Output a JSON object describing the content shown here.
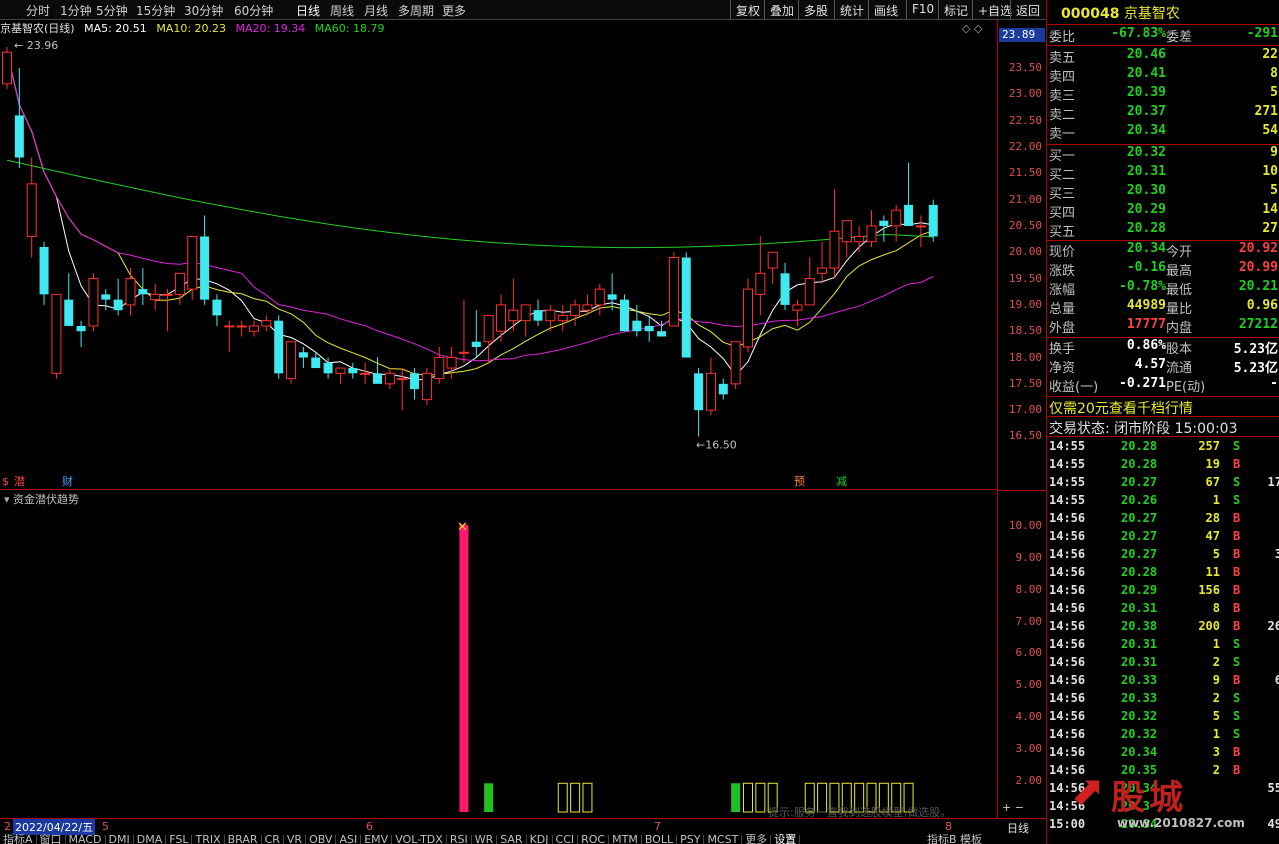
{
  "toolbar": {
    "periods": [
      "分时",
      "1分钟",
      "5分钟",
      "15分钟",
      "30分钟",
      "60分钟",
      "日线",
      "周线",
      "月线",
      "多周期",
      "更多"
    ],
    "active_period": "日线",
    "right_buttons": [
      "复权",
      "叠加",
      "多股",
      "统计",
      "画线",
      "F10",
      "标记",
      "+自选",
      "返回"
    ]
  },
  "ma_line": {
    "title": "京基智农(日线)",
    "ma5": "MA5: 20.51",
    "ma10": "MA10: 20.23",
    "ma20": "MA20: 19.34",
    "ma60": "MA60: 18.79",
    "colors": {
      "ma5": "#ffffff",
      "ma10": "#e8e830",
      "ma20": "#e020e0",
      "ma60": "#20d020"
    }
  },
  "chart_data": [
    {
      "type": "candlestick",
      "ylim": [
        16.3,
        23.9
      ],
      "y_ticks": [
        "23.50",
        "23.00",
        "22.50",
        "22.00",
        "21.50",
        "21.00",
        "20.50",
        "20.00",
        "19.50",
        "19.00",
        "18.50",
        "18.00",
        "17.50",
        "17.00",
        "16.50"
      ],
      "current_price_label": "23.89",
      "annotations": {
        "high": "23.96",
        "low": "16.50"
      },
      "markers": [
        "潜",
        "财",
        "预",
        "减"
      ],
      "candles": [
        {
          "o": 23.2,
          "h": 23.9,
          "l": 23.1,
          "c": 23.8
        },
        {
          "o": 22.6,
          "h": 23.5,
          "l": 21.6,
          "c": 21.8
        },
        {
          "o": 20.3,
          "h": 21.8,
          "l": 19.9,
          "c": 21.3
        },
        {
          "o": 20.1,
          "h": 20.2,
          "l": 19.0,
          "c": 19.2
        },
        {
          "o": 17.7,
          "h": 19.2,
          "l": 17.6,
          "c": 19.2
        },
        {
          "o": 19.1,
          "h": 19.6,
          "l": 18.7,
          "c": 18.6
        },
        {
          "o": 18.6,
          "h": 18.7,
          "l": 18.2,
          "c": 18.5
        },
        {
          "o": 18.6,
          "h": 19.6,
          "l": 18.5,
          "c": 19.5
        },
        {
          "o": 19.2,
          "h": 19.3,
          "l": 18.9,
          "c": 19.1
        },
        {
          "o": 19.1,
          "h": 19.5,
          "l": 18.8,
          "c": 18.9
        },
        {
          "o": 19.0,
          "h": 19.7,
          "l": 18.8,
          "c": 19.5
        },
        {
          "o": 19.3,
          "h": 19.7,
          "l": 19.0,
          "c": 19.2
        },
        {
          "o": 19.1,
          "h": 19.4,
          "l": 18.9,
          "c": 19.2
        },
        {
          "o": 19.2,
          "h": 19.3,
          "l": 18.5,
          "c": 19.2
        },
        {
          "o": 19.2,
          "h": 19.6,
          "l": 19.0,
          "c": 19.6
        },
        {
          "o": 19.3,
          "h": 20.3,
          "l": 19.1,
          "c": 20.3
        },
        {
          "o": 20.3,
          "h": 20.7,
          "l": 19.0,
          "c": 19.1
        },
        {
          "o": 19.1,
          "h": 19.2,
          "l": 18.6,
          "c": 18.8
        },
        {
          "o": 18.6,
          "h": 18.7,
          "l": 18.1,
          "c": 18.6
        },
        {
          "o": 18.6,
          "h": 18.7,
          "l": 18.4,
          "c": 18.6
        },
        {
          "o": 18.5,
          "h": 18.7,
          "l": 18.4,
          "c": 18.6
        },
        {
          "o": 18.6,
          "h": 18.8,
          "l": 18.5,
          "c": 18.7
        },
        {
          "o": 18.7,
          "h": 18.8,
          "l": 17.6,
          "c": 17.7
        },
        {
          "o": 17.6,
          "h": 18.3,
          "l": 17.5,
          "c": 18.3
        },
        {
          "o": 18.1,
          "h": 18.2,
          "l": 17.8,
          "c": 18.0
        },
        {
          "o": 18.0,
          "h": 18.1,
          "l": 17.8,
          "c": 17.8
        },
        {
          "o": 17.9,
          "h": 18.0,
          "l": 17.6,
          "c": 17.7
        },
        {
          "o": 17.7,
          "h": 17.8,
          "l": 17.5,
          "c": 17.8
        },
        {
          "o": 17.8,
          "h": 17.9,
          "l": 17.6,
          "c": 17.7
        },
        {
          "o": 17.7,
          "h": 17.9,
          "l": 17.5,
          "c": 17.7
        },
        {
          "o": 17.7,
          "h": 18.0,
          "l": 17.6,
          "c": 17.5
        },
        {
          "o": 17.5,
          "h": 17.8,
          "l": 17.4,
          "c": 17.7
        },
        {
          "o": 17.6,
          "h": 17.8,
          "l": 17.0,
          "c": 17.6
        },
        {
          "o": 17.7,
          "h": 17.8,
          "l": 17.2,
          "c": 17.4
        },
        {
          "o": 17.2,
          "h": 17.8,
          "l": 17.1,
          "c": 17.7
        },
        {
          "o": 17.6,
          "h": 18.2,
          "l": 17.5,
          "c": 18.0
        },
        {
          "o": 17.8,
          "h": 18.2,
          "l": 17.6,
          "c": 18.0
        },
        {
          "o": 18.1,
          "h": 19.1,
          "l": 17.9,
          "c": 18.1
        },
        {
          "o": 18.3,
          "h": 18.9,
          "l": 18.0,
          "c": 18.2
        },
        {
          "o": 18.3,
          "h": 18.6,
          "l": 17.9,
          "c": 18.8
        },
        {
          "o": 18.5,
          "h": 19.2,
          "l": 18.3,
          "c": 19.0
        },
        {
          "o": 18.7,
          "h": 19.5,
          "l": 18.5,
          "c": 18.9
        },
        {
          "o": 18.7,
          "h": 19.0,
          "l": 18.4,
          "c": 19.0
        },
        {
          "o": 18.9,
          "h": 19.1,
          "l": 18.6,
          "c": 18.7
        },
        {
          "o": 18.7,
          "h": 19.0,
          "l": 18.5,
          "c": 18.9
        },
        {
          "o": 18.7,
          "h": 19.0,
          "l": 18.5,
          "c": 18.8
        },
        {
          "o": 18.8,
          "h": 19.1,
          "l": 18.6,
          "c": 19.0
        },
        {
          "o": 18.9,
          "h": 19.2,
          "l": 18.8,
          "c": 19.0
        },
        {
          "o": 19.0,
          "h": 19.4,
          "l": 18.8,
          "c": 19.3
        },
        {
          "o": 19.2,
          "h": 19.6,
          "l": 18.9,
          "c": 19.1
        },
        {
          "o": 19.1,
          "h": 19.2,
          "l": 18.5,
          "c": 18.5
        },
        {
          "o": 18.7,
          "h": 19.0,
          "l": 18.4,
          "c": 18.5
        },
        {
          "o": 18.6,
          "h": 18.8,
          "l": 18.3,
          "c": 18.5
        },
        {
          "o": 18.5,
          "h": 18.7,
          "l": 18.4,
          "c": 18.4
        },
        {
          "o": 18.6,
          "h": 20.0,
          "l": 18.6,
          "c": 19.9
        },
        {
          "o": 19.9,
          "h": 20.0,
          "l": 18.0,
          "c": 18.0
        },
        {
          "o": 17.7,
          "h": 17.8,
          "l": 16.5,
          "c": 17.0
        },
        {
          "o": 17.0,
          "h": 18.0,
          "l": 16.9,
          "c": 17.7
        },
        {
          "o": 17.5,
          "h": 17.6,
          "l": 17.2,
          "c": 17.3
        },
        {
          "o": 17.5,
          "h": 18.3,
          "l": 17.4,
          "c": 18.3
        },
        {
          "o": 18.2,
          "h": 19.5,
          "l": 18.1,
          "c": 19.3
        },
        {
          "o": 19.2,
          "h": 20.3,
          "l": 18.8,
          "c": 19.6
        },
        {
          "o": 19.7,
          "h": 20.0,
          "l": 19.4,
          "c": 20.0
        },
        {
          "o": 19.6,
          "h": 19.8,
          "l": 18.9,
          "c": 19.0
        },
        {
          "o": 18.9,
          "h": 19.1,
          "l": 18.6,
          "c": 19.0
        },
        {
          "o": 19.0,
          "h": 19.9,
          "l": 19.0,
          "c": 19.5
        },
        {
          "o": 19.6,
          "h": 20.2,
          "l": 19.4,
          "c": 19.7
        },
        {
          "o": 19.7,
          "h": 21.2,
          "l": 19.5,
          "c": 20.4
        },
        {
          "o": 20.2,
          "h": 20.6,
          "l": 19.9,
          "c": 20.6
        },
        {
          "o": 20.2,
          "h": 20.5,
          "l": 20.0,
          "c": 20.3
        },
        {
          "o": 20.2,
          "h": 20.8,
          "l": 20.1,
          "c": 20.5
        },
        {
          "o": 20.6,
          "h": 20.7,
          "l": 20.2,
          "c": 20.5
        },
        {
          "o": 20.5,
          "h": 20.9,
          "l": 20.2,
          "c": 20.8
        },
        {
          "o": 20.9,
          "h": 21.7,
          "l": 20.5,
          "c": 20.5
        },
        {
          "o": 20.5,
          "h": 20.7,
          "l": 20.1,
          "c": 20.5
        },
        {
          "o": 20.9,
          "h": 21.0,
          "l": 20.2,
          "c": 20.3
        }
      ]
    },
    {
      "type": "bar",
      "title": "资金潜伏趋势",
      "ylim": [
        1.0,
        10.4
      ],
      "y_ticks": [
        "10.00",
        "9.00",
        "8.00",
        "7.00",
        "6.00",
        "5.00",
        "4.00",
        "3.00",
        "2.00"
      ],
      "bars": [
        {
          "i": 37,
          "v": 10.0,
          "style": "filled-pink"
        },
        {
          "i": 39,
          "v": 1.9,
          "style": "filled-green"
        },
        {
          "i": 45,
          "v": 1.9,
          "style": "outline-yellow"
        },
        {
          "i": 46,
          "v": 1.9,
          "style": "outline-yellow"
        },
        {
          "i": 47,
          "v": 1.9,
          "style": "outline-yellow"
        },
        {
          "i": 59,
          "v": 1.9,
          "style": "filled-green"
        },
        {
          "i": 60,
          "v": 1.9,
          "style": "outline-yellow"
        },
        {
          "i": 61,
          "v": 1.9,
          "style": "outline-yellow"
        },
        {
          "i": 62,
          "v": 1.9,
          "style": "outline-yellow"
        },
        {
          "i": 65,
          "v": 1.9,
          "style": "outline-yellow"
        },
        {
          "i": 66,
          "v": 1.9,
          "style": "outline-yellow"
        },
        {
          "i": 67,
          "v": 1.9,
          "style": "outline-yellow"
        },
        {
          "i": 68,
          "v": 1.9,
          "style": "outline-yellow"
        },
        {
          "i": 69,
          "v": 1.9,
          "style": "outline-yellow"
        },
        {
          "i": 70,
          "v": 1.9,
          "style": "outline-yellow"
        },
        {
          "i": 71,
          "v": 1.9,
          "style": "outline-yellow"
        },
        {
          "i": 72,
          "v": 1.9,
          "style": "outline-yellow"
        },
        {
          "i": 73,
          "v": 1.9,
          "style": "outline-yellow"
        }
      ]
    }
  ],
  "date_bar": {
    "date": "2022/04/22/五",
    "months": [
      "5",
      "6",
      "7",
      "8"
    ],
    "right_label": "日线",
    "first": "2"
  },
  "tabs": [
    "指标A",
    "窗口",
    "MACD",
    "DMI",
    "DMA",
    "FSL",
    "TRIX",
    "BRAR",
    "CR",
    "VR",
    "OBV",
    "ASI",
    "EMV",
    "VOL-TDX",
    "RSI",
    "WR",
    "SAR",
    "KDJ",
    "CCI",
    "ROC",
    "MTM",
    "BOLL",
    "PSY",
    "MCST",
    "更多",
    "设置"
  ],
  "tabs_right": [
    "指标B",
    "模板"
  ],
  "watermark": "提示:服务一直我到选股模型,做选股。",
  "panel": {
    "code": "000048",
    "name": "京基智农",
    "weibi": {
      "label": "委比",
      "value": "-67.83%",
      "label2": "委差",
      "value2": "-291"
    },
    "sells": [
      {
        "label": "卖五",
        "price": "20.46",
        "vol": "22"
      },
      {
        "label": "卖四",
        "price": "20.41",
        "vol": "8"
      },
      {
        "label": "卖三",
        "price": "20.39",
        "vol": "5"
      },
      {
        "label": "卖二",
        "price": "20.37",
        "vol": "271"
      },
      {
        "label": "卖一",
        "price": "20.34",
        "vol": "54"
      }
    ],
    "buys": [
      {
        "label": "买一",
        "price": "20.32",
        "vol": "9"
      },
      {
        "label": "买二",
        "price": "20.31",
        "vol": "10"
      },
      {
        "label": "买三",
        "price": "20.30",
        "vol": "5"
      },
      {
        "label": "买四",
        "price": "20.29",
        "vol": "14"
      },
      {
        "label": "买五",
        "price": "20.28",
        "vol": "27"
      }
    ],
    "quote": [
      {
        "l": "现价",
        "m": "20.34",
        "l2": "今开",
        "r": "20.92",
        "mc": "green",
        "rc": "red"
      },
      {
        "l": "涨跌",
        "m": "-0.16",
        "l2": "最高",
        "r": "20.99",
        "mc": "green",
        "rc": "red"
      },
      {
        "l": "涨幅",
        "m": "-0.78%",
        "l2": "最低",
        "r": "20.21",
        "mc": "green",
        "rc": "green"
      },
      {
        "l": "总量",
        "m": "44989",
        "l2": "量比",
        "r": "0.96",
        "mc": "yellow",
        "rc": "yellow"
      },
      {
        "l": "外盘",
        "m": "17777",
        "l2": "内盘",
        "r": "27212",
        "mc": "red",
        "rc": "green"
      }
    ],
    "fin": [
      {
        "l": "换手",
        "m": "0.86%",
        "l2": "股本",
        "r": "5.23亿"
      },
      {
        "l": "净资",
        "m": "4.57",
        "l2": "流通",
        "r": "5.23亿"
      },
      {
        "l": "收益(一)",
        "m": "-0.271",
        "l2": "PE(动)",
        "r": "-"
      }
    ],
    "promo": "仅需20元查看千档行情",
    "status": "交易状态: 闭市阶段 15:00:03",
    "ticks": [
      {
        "t": "14:55",
        "p": "20.28",
        "v": "257",
        "d": "S",
        "n": "",
        "pc": "green"
      },
      {
        "t": "14:55",
        "p": "20.28",
        "v": "19",
        "d": "B",
        "n": "",
        "pc": "green"
      },
      {
        "t": "14:55",
        "p": "20.27",
        "v": "67",
        "d": "S",
        "n": "17",
        "pc": "green"
      },
      {
        "t": "14:55",
        "p": "20.26",
        "v": "1",
        "d": "S",
        "n": "",
        "pc": "green"
      },
      {
        "t": "14:56",
        "p": "20.27",
        "v": "28",
        "d": "B",
        "n": "",
        "pc": "green"
      },
      {
        "t": "14:56",
        "p": "20.27",
        "v": "47",
        "d": "B",
        "n": "",
        "pc": "green"
      },
      {
        "t": "14:56",
        "p": "20.27",
        "v": "5",
        "d": "B",
        "n": "3",
        "pc": "green"
      },
      {
        "t": "14:56",
        "p": "20.28",
        "v": "11",
        "d": "B",
        "n": "",
        "pc": "green"
      },
      {
        "t": "14:56",
        "p": "20.29",
        "v": "156",
        "d": "B",
        "n": "",
        "pc": "green"
      },
      {
        "t": "14:56",
        "p": "20.31",
        "v": "8",
        "d": "B",
        "n": "",
        "pc": "green"
      },
      {
        "t": "14:56",
        "p": "20.38",
        "v": "200",
        "d": "B",
        "n": "26",
        "pc": "green"
      },
      {
        "t": "14:56",
        "p": "20.31",
        "v": "1",
        "d": "S",
        "n": "",
        "pc": "green"
      },
      {
        "t": "14:56",
        "p": "20.31",
        "v": "2",
        "d": "S",
        "n": "",
        "pc": "green"
      },
      {
        "t": "14:56",
        "p": "20.33",
        "v": "9",
        "d": "B",
        "n": "6",
        "pc": "green"
      },
      {
        "t": "14:56",
        "p": "20.33",
        "v": "2",
        "d": "S",
        "n": "",
        "pc": "green"
      },
      {
        "t": "14:56",
        "p": "20.32",
        "v": "5",
        "d": "S",
        "n": "",
        "pc": "green"
      },
      {
        "t": "14:56",
        "p": "20.32",
        "v": "1",
        "d": "S",
        "n": "",
        "pc": "green"
      },
      {
        "t": "14:56",
        "p": "20.34",
        "v": "3",
        "d": "B",
        "n": "",
        "pc": "green"
      },
      {
        "t": "14:56",
        "p": "20.35",
        "v": "2",
        "d": "B",
        "n": "",
        "pc": "green"
      },
      {
        "t": "14:56",
        "p": "20.34",
        "v": "",
        "d": "",
        "n": "55",
        "pc": "green"
      },
      {
        "t": "14:56",
        "p": "20.3",
        "v": "",
        "d": "",
        "n": "",
        "pc": "green"
      },
      {
        "t": "15:00",
        "p": "20.34",
        "v": "",
        "d": "",
        "n": "49",
        "pc": "green"
      }
    ],
    "logo_text": "股城",
    "logo_url": "www.2010827.com"
  }
}
